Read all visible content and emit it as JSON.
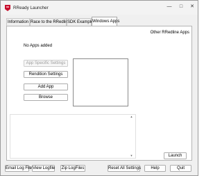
{
  "window": {
    "title": "RReady Launcher",
    "accent_color": "#c8102e"
  },
  "tabs": [
    {
      "label": "Information",
      "active": false
    },
    {
      "label": "Race to the RRedline!",
      "active": false
    },
    {
      "label": "SDK Examples",
      "active": false
    },
    {
      "label": "Windows Apps",
      "active": true
    }
  ],
  "panel": {
    "other_apps_label": "Other RRedline Apps",
    "no_apps_text": "No Apps added",
    "buttons": {
      "app_specific_settings": "App Specific Settings",
      "rendition_settings": "Rendition Settings",
      "add_app": "Add App",
      "browse": "Browse",
      "launch": "Launch"
    }
  },
  "bottom_bar": {
    "email_log_file": "Email Log File",
    "view_logfile": "View Logfile",
    "zip_logfiles": "Zip LogFiles",
    "reset_all_settings": "Reset All Settings",
    "help": "Help",
    "quit": "Quit"
  },
  "icons": {
    "app": "rready-logo-icon",
    "minimize": "minimize-icon",
    "maximize": "maximize-icon",
    "close": "close-icon"
  }
}
